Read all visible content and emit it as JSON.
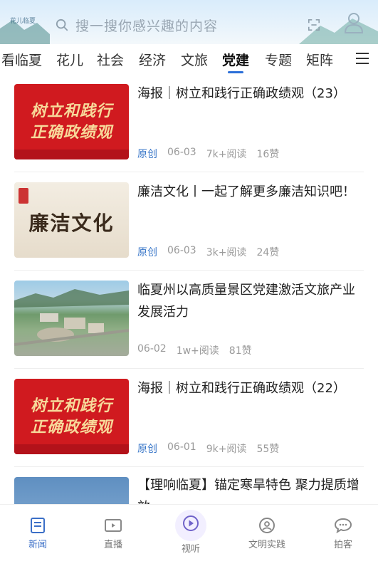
{
  "header": {
    "logo_text": "花儿临夏",
    "search_placeholder": "搜一搜你感兴趣的内容"
  },
  "tabs": [
    {
      "label": "看临夏",
      "active": false
    },
    {
      "label": "花儿",
      "active": false
    },
    {
      "label": "社会",
      "active": false
    },
    {
      "label": "经济",
      "active": false
    },
    {
      "label": "文旅",
      "active": false
    },
    {
      "label": "党建",
      "active": true
    },
    {
      "label": "专题",
      "active": false
    },
    {
      "label": "矩阵",
      "active": false
    }
  ],
  "news": [
    {
      "title": "海报｜树立和践行正确政绩观（23）",
      "source": "原创",
      "date": "06-03",
      "reads": "7k+阅读",
      "likes": "16赞",
      "thumb": {
        "type": "poster",
        "line1": "树立和践行",
        "line2": "正确政绩观"
      }
    },
    {
      "title": "廉洁文化丨一起了解更多廉洁知识吧！",
      "source": "原创",
      "date": "06-03",
      "reads": "3k+阅读",
      "likes": "24赞",
      "thumb": {
        "type": "lianjie",
        "text": "廉洁文化"
      }
    },
    {
      "title": "临夏州以高质量景区党建激活文旅产业发展活力",
      "source": "",
      "date": "06-02",
      "reads": "1w+阅读",
      "likes": "81赞",
      "thumb": {
        "type": "aerial"
      }
    },
    {
      "title": "海报｜树立和践行正确政绩观（22）",
      "source": "原创",
      "date": "06-01",
      "reads": "9k+阅读",
      "likes": "55赞",
      "thumb": {
        "type": "poster",
        "line1": "树立和践行",
        "line2": "正确政绩观"
      }
    },
    {
      "title": "【理响临夏】锚定寒旱特色 聚力提质增效",
      "source": "",
      "date": "",
      "reads": "",
      "likes": "",
      "thumb": {
        "type": "partial"
      }
    }
  ],
  "bottom_nav": [
    {
      "label": "新闻",
      "icon": "news-icon",
      "active": true
    },
    {
      "label": "直播",
      "icon": "live-icon",
      "active": false
    },
    {
      "label": "视听",
      "icon": "play-icon",
      "active": false
    },
    {
      "label": "文明实践",
      "icon": "civilization-icon",
      "active": false
    },
    {
      "label": "拍客",
      "icon": "chat-icon",
      "active": false
    }
  ],
  "colors": {
    "accent": "#2b6fd8",
    "source_blue": "#3b78c9",
    "poster_red": "#d01a1f"
  }
}
